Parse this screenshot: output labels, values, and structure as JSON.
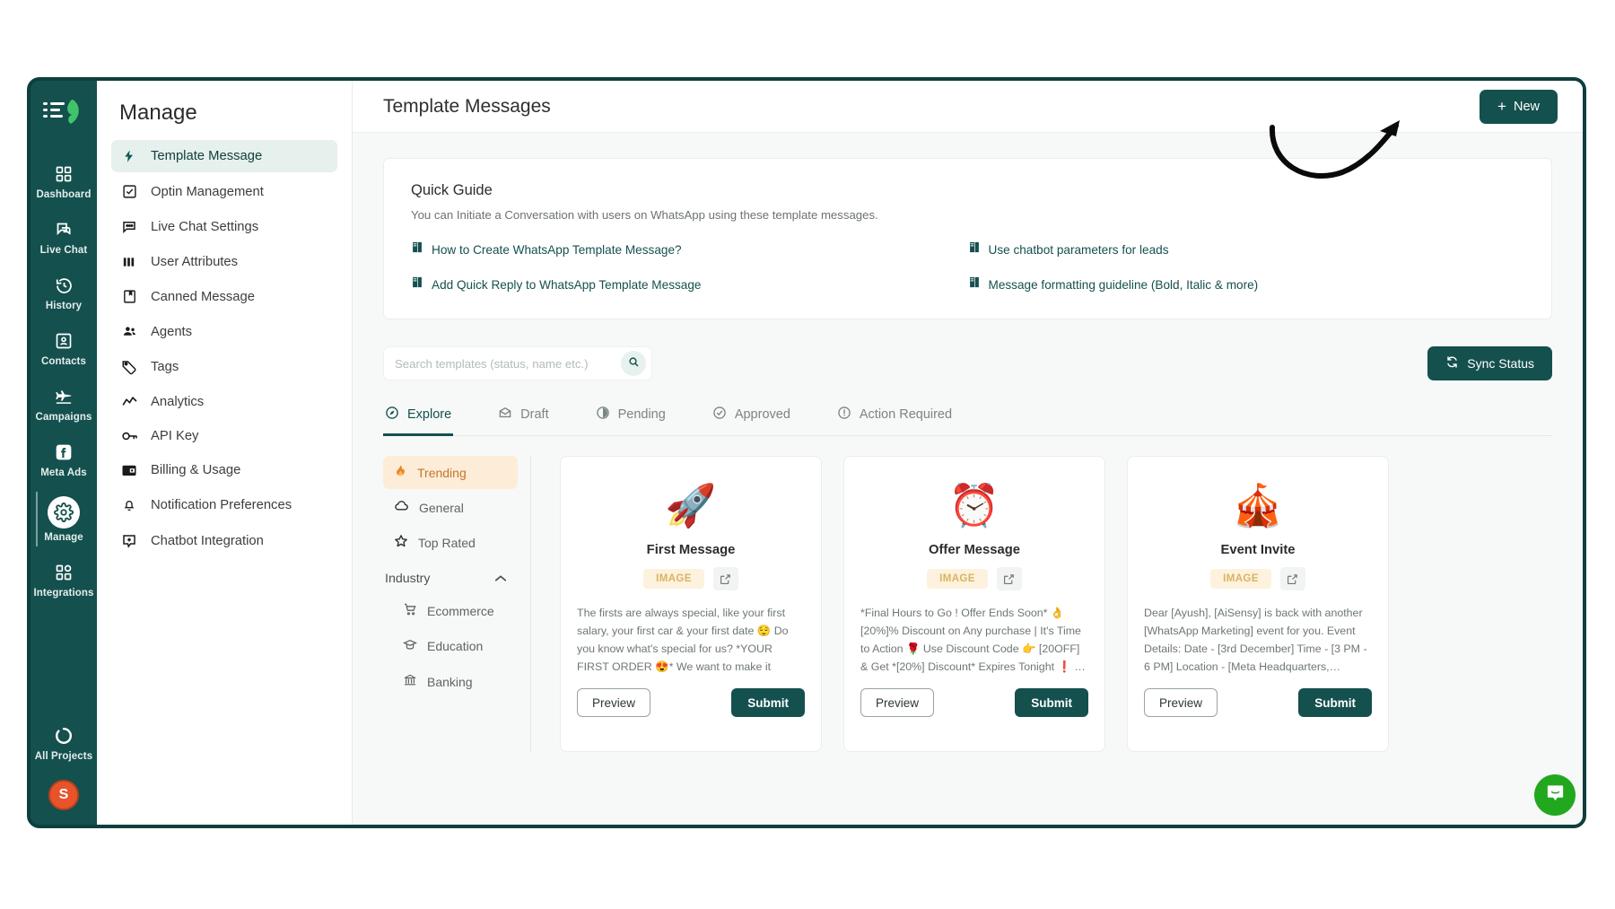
{
  "rail": {
    "logo_alt": "aisensy-logo",
    "items": [
      {
        "label": "Dashboard",
        "icon": "grid-icon",
        "active": false
      },
      {
        "label": "Live Chat",
        "icon": "chat-icon",
        "active": false
      },
      {
        "label": "History",
        "icon": "history-icon",
        "active": false
      },
      {
        "label": "Contacts",
        "icon": "contacts-icon",
        "active": false
      },
      {
        "label": "Campaigns",
        "icon": "send-icon",
        "active": false
      },
      {
        "label": "Meta Ads",
        "icon": "facebook-icon",
        "active": false
      },
      {
        "label": "Manage",
        "icon": "gear-icon",
        "active": true
      },
      {
        "label": "Integrations",
        "icon": "integrations-icon",
        "active": false
      }
    ],
    "all_projects_label": "All Projects",
    "avatar_initial": "S"
  },
  "subnav": {
    "title": "Manage",
    "items": [
      {
        "label": "Template Message",
        "icon": "bolt-icon",
        "active": true
      },
      {
        "label": "Optin Management",
        "icon": "checkbox-icon",
        "active": false
      },
      {
        "label": "Live Chat Settings",
        "icon": "message-dots-icon",
        "active": false
      },
      {
        "label": "User Attributes",
        "icon": "columns-icon",
        "active": false
      },
      {
        "label": "Canned Message",
        "icon": "bookmark-note-icon",
        "active": false
      },
      {
        "label": "Agents",
        "icon": "people-icon",
        "active": false
      },
      {
        "label": "Tags",
        "icon": "tag-icon",
        "active": false
      },
      {
        "label": "Analytics",
        "icon": "trend-line-icon",
        "active": false
      },
      {
        "label": "API Key",
        "icon": "key-icon",
        "active": false
      },
      {
        "label": "Billing & Usage",
        "icon": "wallet-icon",
        "active": false
      },
      {
        "label": "Notification Preferences",
        "icon": "bell-icon",
        "active": false
      },
      {
        "label": "Chatbot Integration",
        "icon": "plus-badge-icon",
        "active": false
      }
    ]
  },
  "topbar": {
    "title": "Template Messages",
    "new_button": "New",
    "new_button_icon": "plus-icon"
  },
  "quick_guide": {
    "title": "Quick Guide",
    "subtitle": "You can Initiate a Conversation with users on WhatsApp using these template messages.",
    "links": [
      {
        "label": "How to Create WhatsApp Template Message?",
        "icon": "book-icon"
      },
      {
        "label": "Use chatbot parameters for leads",
        "icon": "book-icon"
      },
      {
        "label": "Add Quick Reply to WhatsApp Template Message",
        "icon": "book-icon"
      },
      {
        "label": "Message formatting guideline (Bold, Italic & more)",
        "icon": "book-icon"
      }
    ]
  },
  "search": {
    "placeholder": "Search templates (status, name etc.)",
    "value": "",
    "icon": "search-icon"
  },
  "sync": {
    "label": "Sync Status",
    "icon": "sync-icon"
  },
  "tabs": [
    {
      "label": "Explore",
      "icon": "compass-icon",
      "active": true
    },
    {
      "label": "Draft",
      "icon": "envelope-icon",
      "active": false
    },
    {
      "label": "Pending",
      "icon": "half-circle-icon",
      "active": false
    },
    {
      "label": "Approved",
      "icon": "check-circle-icon",
      "active": false
    },
    {
      "label": "Action Required",
      "icon": "alert-circle-icon",
      "active": false
    }
  ],
  "categories": {
    "top": [
      {
        "label": "Trending",
        "icon": "fire-icon",
        "active": true
      },
      {
        "label": "General",
        "icon": "cloud-icon",
        "active": false
      },
      {
        "label": "Top Rated",
        "icon": "star-icon",
        "active": false
      }
    ],
    "group": {
      "label": "Industry",
      "chevron": "chevron-up-icon",
      "expanded": true
    },
    "industry": [
      {
        "label": "Ecommerce",
        "icon": "cart-icon"
      },
      {
        "label": "Education",
        "icon": "graduation-cap-icon"
      },
      {
        "label": "Banking",
        "icon": "bank-icon"
      }
    ]
  },
  "cards": [
    {
      "emoji": "🚀",
      "emoji_name": "rocket-emoji",
      "title": "First Message",
      "badge": "IMAGE",
      "body": "The firsts are always special, like your first salary, your first car & your first date 😌 Do you know what's special for us? *YOUR FIRST ORDER 😍* We want to make it special for…",
      "preview_label": "Preview",
      "submit_label": "Submit"
    },
    {
      "emoji": "⏰",
      "emoji_name": "limited-offer-emoji",
      "title": "Offer Message",
      "badge": "IMAGE",
      "body": "*Final Hours to Go ! Offer Ends Soon* 👌 [20%]% Discount on Any purchase | It's Time to Action 🌹 Use Discount Code 👉 [20OFF] & Get *[20%] Discount* Expires Tonight ❗ …",
      "preview_label": "Preview",
      "submit_label": "Submit"
    },
    {
      "emoji": "🎪",
      "emoji_name": "event-banner-emoji",
      "title": "Event Invite",
      "badge": "IMAGE",
      "body": "Dear [Ayush], [AiSensy] is back with another [WhatsApp Marketing] event for you. Event Details: Date - [3rd December] Time - [3 PM - 6 PM] Location - [Meta Headquarters,…",
      "preview_label": "Preview",
      "submit_label": "Submit"
    }
  ],
  "chat_widget": {
    "icon": "intercom-chat-icon"
  },
  "colors": {
    "brand_dark": "#14504e",
    "rail_bg": "#14504e",
    "accent_orange": "#c3762a",
    "badge_bg": "#fdf2dd",
    "avatar_bg": "#e8532a",
    "chat_green": "#22a81f"
  }
}
